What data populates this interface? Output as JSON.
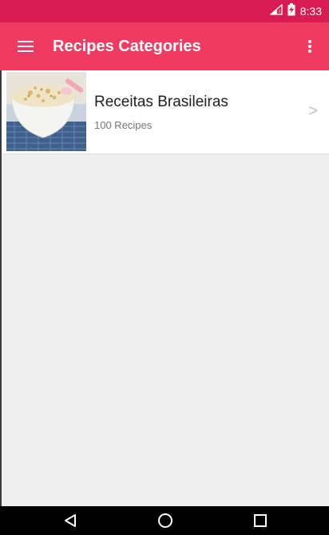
{
  "status_bar": {
    "time": "8:33",
    "icons": [
      "signal-icon",
      "battery-charging-icon"
    ],
    "background": "#d81b52"
  },
  "app_bar": {
    "title": "Recipes Categories",
    "background": "#ef3b62",
    "menu_icon": "hamburger-menu-icon",
    "overflow_icon": "more-vert-icon"
  },
  "categories": [
    {
      "title": "Receitas Brasileiras",
      "subtitle": "100 Recipes",
      "chevron": ">",
      "thumbnail": "rice-pudding-bowl-image"
    }
  ],
  "nav_bar": {
    "buttons": [
      "back-icon",
      "home-icon",
      "recents-icon"
    ]
  },
  "colors": {
    "accent": "#ef3b62",
    "status": "#d81b52",
    "background": "#eeeeee"
  }
}
